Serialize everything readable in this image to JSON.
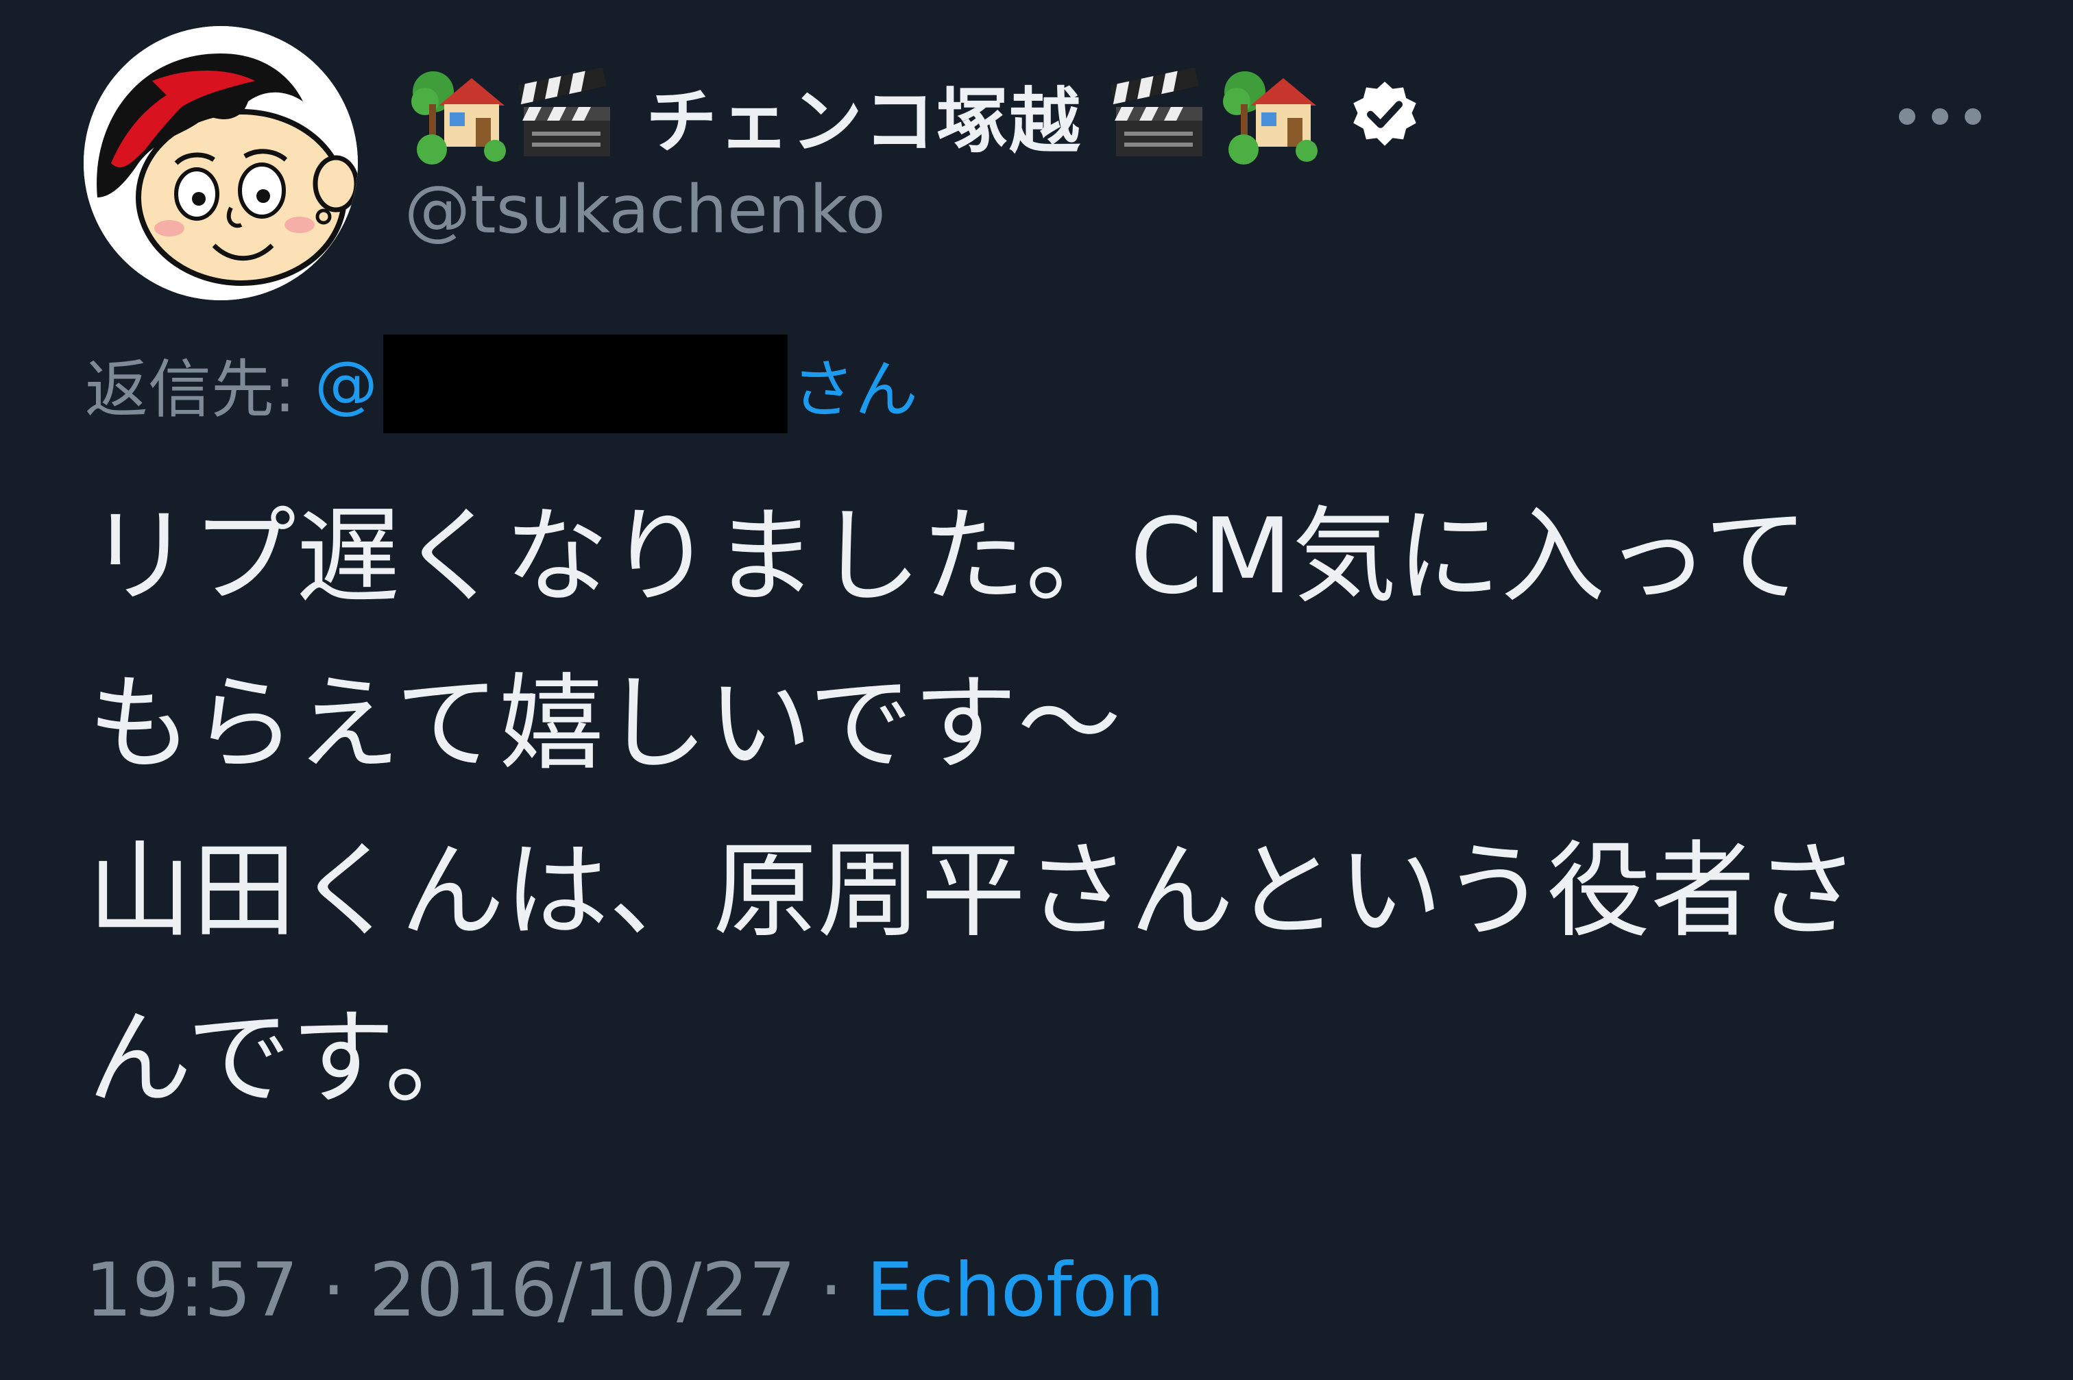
{
  "author": {
    "display_name": "チェンコ塚越",
    "handle": "@tsukachenko",
    "verified": true,
    "name_decorations_left": [
      "house-with-garden-icon",
      "clapper-board-icon"
    ],
    "name_decorations_right": [
      "clapper-board-icon",
      "house-with-garden-icon"
    ]
  },
  "reply": {
    "label": "返信先:",
    "at": "@",
    "suffix": "さん"
  },
  "tweet": {
    "text": "リプ遅くなりました。CM気に入って\nもらえて嬉しいです〜\n山田くんは、原周平さんという役者さ\nんです。"
  },
  "meta": {
    "time": "19:57",
    "separator": "·",
    "date": "2016/10/27",
    "source": "Echofon"
  },
  "colors": {
    "background": "#151d28",
    "text": "#eef1f4",
    "muted": "#7e8a96",
    "link": "#1d9bf0"
  }
}
